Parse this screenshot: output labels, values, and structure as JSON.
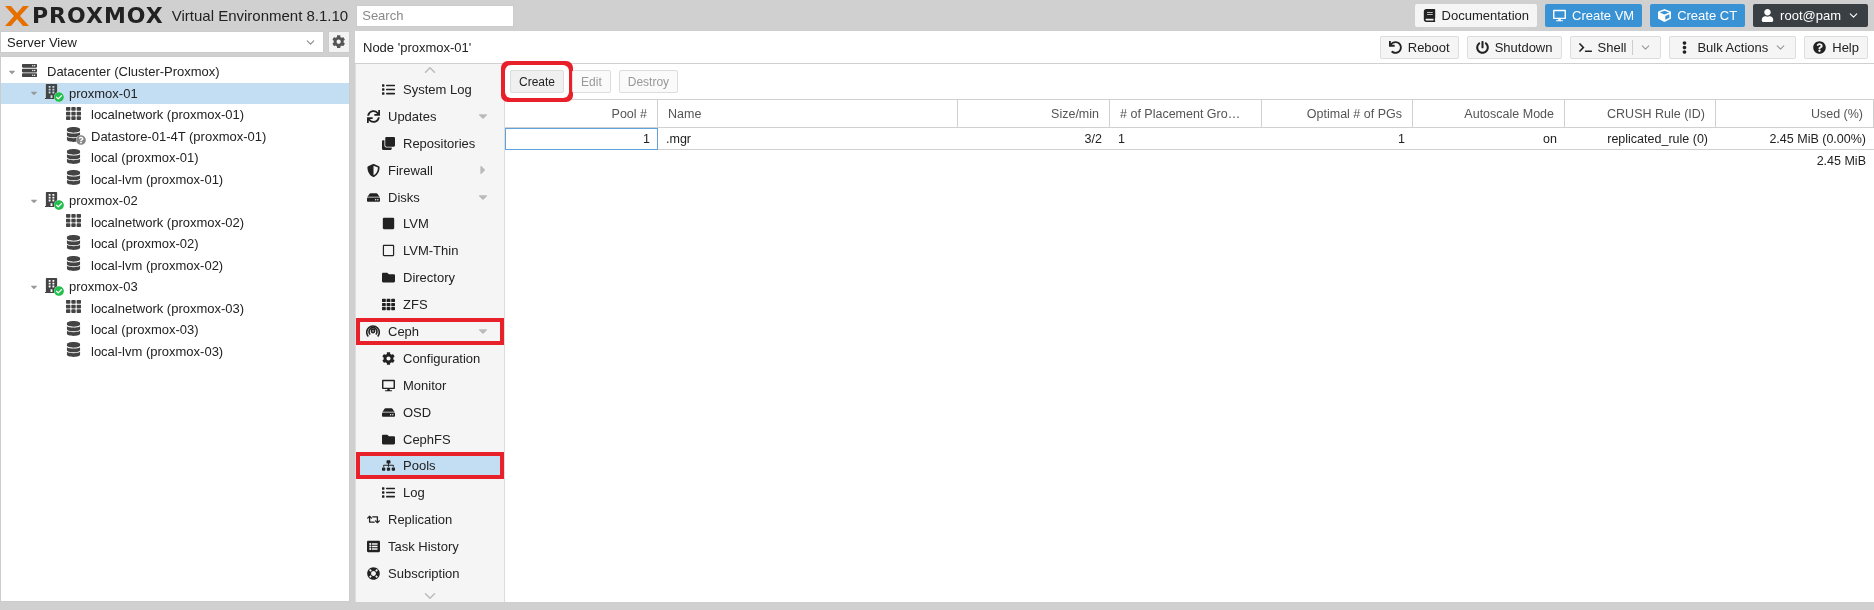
{
  "header": {
    "logo": "PROXMOX",
    "product": "Virtual Environment 8.1.10",
    "search": {
      "placeholder": "Search"
    },
    "buttons": [
      {
        "label": "Documentation",
        "kind": "docs"
      },
      {
        "label": "Create VM",
        "kind": "vm"
      },
      {
        "label": "Create CT",
        "kind": "ct"
      },
      {
        "label": "root@pam",
        "kind": "user"
      }
    ]
  },
  "sidebar": {
    "view_selector": {
      "value": "Server View"
    },
    "tree": [
      {
        "label": "Datacenter (Cluster-Proxmox)",
        "kind": "datacenter",
        "selected": false,
        "expanded": true,
        "children": [
          {
            "label": "proxmox-01",
            "kind": "node",
            "selected": true,
            "expanded": true,
            "children": [
              {
                "label": "localnetwork (proxmox-01)",
                "kind": "network",
                "selected": false
              },
              {
                "label": "Datastore-01-4T (proxmox-01)",
                "kind": "storage-unknown",
                "selected": false
              },
              {
                "label": "local (proxmox-01)",
                "kind": "storage-active",
                "selected": false
              },
              {
                "label": "local-lvm (proxmox-01)",
                "kind": "storage",
                "selected": false
              }
            ]
          },
          {
            "label": "proxmox-02",
            "kind": "node",
            "selected": false,
            "expanded": true,
            "children": [
              {
                "label": "localnetwork (proxmox-02)",
                "kind": "network",
                "selected": false
              },
              {
                "label": "local (proxmox-02)",
                "kind": "storage",
                "selected": false
              },
              {
                "label": "local-lvm (proxmox-02)",
                "kind": "storage",
                "selected": false
              }
            ]
          },
          {
            "label": "proxmox-03",
            "kind": "node",
            "selected": false,
            "expanded": true,
            "children": [
              {
                "label": "localnetwork (proxmox-03)",
                "kind": "network",
                "selected": false
              },
              {
                "label": "local (proxmox-03)",
                "kind": "storage",
                "selected": false
              },
              {
                "label": "local-lvm (proxmox-03)",
                "kind": "storage",
                "selected": false
              }
            ]
          }
        ]
      }
    ]
  },
  "panel": {
    "title": "Node 'proxmox-01'",
    "toolbar": [
      {
        "label": "Reboot",
        "kind": "reboot"
      },
      {
        "label": "Shutdown",
        "kind": "shutdown"
      },
      {
        "label": "Shell",
        "kind": "shell"
      },
      {
        "label": "Bulk Actions",
        "kind": "bulk"
      },
      {
        "label": "Help",
        "kind": "help"
      }
    ]
  },
  "menu": [
    {
      "children": [
        {
          "label": "System Log",
          "kind": "list",
          "selected": false,
          "highlighted": false
        }
      ]
    },
    {
      "label": "Updates",
      "kind": "sync",
      "selected": false,
      "highlighted": false,
      "expanded": true,
      "children": [
        {
          "label": "Repositories",
          "kind": "clone",
          "selected": false,
          "highlighted": false
        }
      ]
    },
    {
      "label": "Firewall",
      "kind": "shield",
      "selected": false,
      "highlighted": false,
      "expanded": false
    },
    {
      "label": "Disks",
      "kind": "hdd",
      "selected": false,
      "highlighted": false,
      "expanded": true,
      "children": [
        {
          "label": "LVM",
          "kind": "square",
          "selected": false,
          "highlighted": false
        },
        {
          "label": "LVM-Thin",
          "kind": "square-outline",
          "selected": false,
          "highlighted": false
        },
        {
          "label": "Directory",
          "kind": "folder",
          "selected": false,
          "highlighted": false
        },
        {
          "label": "ZFS",
          "kind": "grid",
          "selected": false,
          "highlighted": false
        }
      ]
    },
    {
      "label": "Ceph",
      "kind": "ceph",
      "selected": false,
      "highlighted": true,
      "expanded": true,
      "children": [
        {
          "label": "Configuration",
          "kind": "gear",
          "selected": false,
          "highlighted": false
        },
        {
          "label": "Monitor",
          "kind": "monitor",
          "selected": false,
          "highlighted": false
        },
        {
          "label": "OSD",
          "kind": "hdd",
          "selected": false,
          "highlighted": false
        },
        {
          "label": "CephFS",
          "kind": "folder",
          "selected": false,
          "highlighted": false
        },
        {
          "label": "Pools",
          "kind": "sitemap",
          "selected": true,
          "highlighted": true
        },
        {
          "label": "Log",
          "kind": "list",
          "selected": false,
          "highlighted": false
        }
      ]
    },
    {
      "label": "Replication",
      "kind": "retweet",
      "selected": false,
      "highlighted": false
    },
    {
      "label": "Task History",
      "kind": "listalt",
      "selected": false,
      "highlighted": false
    },
    {
      "label": "Subscription",
      "kind": "lifering",
      "selected": false,
      "highlighted": false
    }
  ],
  "pools": {
    "actions": [
      {
        "label": "Create",
        "disabled": false,
        "highlighted": true
      },
      {
        "label": "Edit",
        "disabled": true,
        "highlighted": false
      },
      {
        "label": "Destroy",
        "disabled": true,
        "highlighted": false
      }
    ],
    "table": {
      "columns": [
        {
          "label": "Pool #"
        },
        {
          "label": "Name"
        },
        {
          "label": "Size/min"
        },
        {
          "label": "# of Placement Gro…"
        },
        {
          "label": "Optimal # of PGs"
        },
        {
          "label": "Autoscale Mode"
        },
        {
          "label": "CRUSH Rule (ID)"
        },
        {
          "label": "Used (%)"
        }
      ],
      "rows": [
        {
          "cells": [
            "1",
            ".mgr",
            "3/2",
            "1",
            "1",
            "on",
            "replicated_rule (0)",
            "2.45 MiB (0.00%)"
          ],
          "selected": true
        }
      ],
      "summary": "2.45 MiB"
    }
  }
}
